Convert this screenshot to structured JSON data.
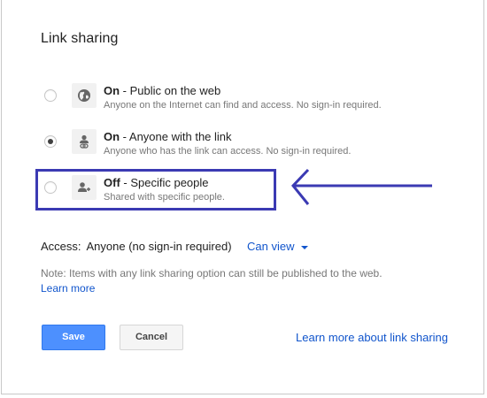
{
  "dialog": {
    "title": "Link sharing"
  },
  "options": [
    {
      "state": "On",
      "separator": " - ",
      "label": "Public on the web",
      "description": "Anyone on the Internet can find and access. No sign-in required.",
      "icon": "globe-icon",
      "selected": false
    },
    {
      "state": "On",
      "separator": " - ",
      "label": "Anyone with the link",
      "description": "Anyone who has the link can access. No sign-in required.",
      "icon": "person-link-icon",
      "selected": true
    },
    {
      "state": "Off",
      "separator": " - ",
      "label": "Specific people",
      "description": "Shared with specific people.",
      "icon": "people-icon",
      "selected": false
    }
  ],
  "access": {
    "label": "Access:",
    "value": "Anyone (no sign-in required)",
    "permission": "Can view"
  },
  "note": {
    "text": "Note: Items with any link sharing option can still be published to the web.",
    "link": "Learn more"
  },
  "buttons": {
    "save": "Save",
    "cancel": "Cancel"
  },
  "footer_link": "Learn more about link sharing",
  "colors": {
    "link": "#1155cc",
    "primary_button": "#4d90fe",
    "annotation": "#3b3ab3"
  }
}
